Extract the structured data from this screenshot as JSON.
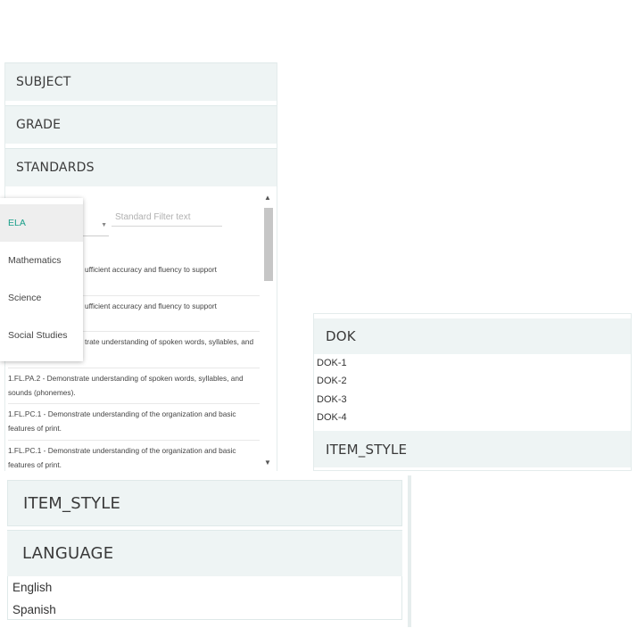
{
  "left_panel": {
    "sections": [
      "SUBJECT",
      "GRADE",
      "STANDARDS"
    ],
    "filter_placeholder": "Standard Filter text",
    "standards": [
      "1.FL.PA.2 - Demonstrate understanding of spoken words, syllables, and sounds (phonemes).",
      "1.FL.PA.2 - Demonstrate understanding of spoken words, syllables, and sounds (phonemes).",
      "1.FL.PC.1 - Demonstrate understanding of the organization and basic features of print.",
      "1.FL.PC.1 - Demonstrate understanding of the organization and basic features of print."
    ],
    "partial_items": [
      "ufficient accuracy and fluency to support",
      "ufficient accuracy and fluency to support",
      "trate understanding of spoken words, syllables, and"
    ]
  },
  "subject_dropdown": {
    "options": [
      "ELA",
      "Mathematics",
      "Science",
      "Social Studies"
    ],
    "selected": "ELA"
  },
  "right_panel": {
    "dok_title": "DOK",
    "dok_items": [
      "DOK-1",
      "DOK-2",
      "DOK-3",
      "DOK-4"
    ],
    "item_style_title": "ITEM_STYLE"
  },
  "bottom_panel": {
    "item_style_title": "ITEM_STYLE",
    "language_title": "LANGUAGE",
    "languages": [
      "English",
      "Spanish"
    ]
  },
  "colors": {
    "header_bg": "#eef4f4",
    "accent": "#1a9f8a",
    "scroll_thumb": "#c6c6c6"
  }
}
